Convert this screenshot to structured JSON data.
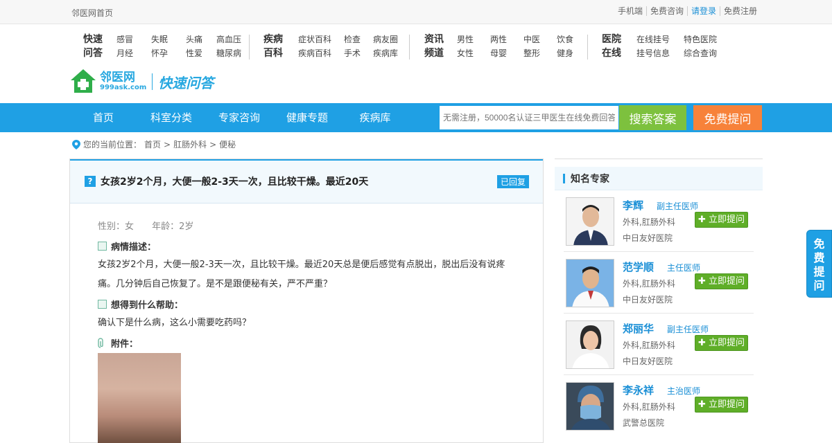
{
  "topbar": {
    "home": "邻医网首页",
    "links": [
      "手机端",
      "免费咨询",
      "请登录",
      "免费注册"
    ]
  },
  "menu": [
    {
      "cat": [
        "快速",
        "问答"
      ],
      "items": [
        "感冒",
        "月经",
        "失眠",
        "怀孕",
        "头痛",
        "性爱",
        "高血压",
        "糖尿病"
      ]
    },
    {
      "cat": [
        "疾病",
        "百科"
      ],
      "items": [
        "症状百科",
        "疾病百科",
        "检查",
        "手术",
        "病友圈",
        "疾病库"
      ]
    },
    {
      "cat": [
        "资讯",
        "频道"
      ],
      "items": [
        "男性",
        "女性",
        "两性",
        "母婴",
        "中医",
        "整形",
        "饮食",
        "健身"
      ]
    },
    {
      "cat": [
        "医院",
        "在线"
      ],
      "items": [
        "在线挂号",
        "挂号信息",
        "特色医院",
        "综合查询"
      ]
    }
  ],
  "logo": {
    "name": "邻医网",
    "domain": "999ask.com",
    "tagline": "快速问答"
  },
  "nav": {
    "items": [
      "首页",
      "科室分类",
      "专家咨询",
      "健康专题",
      "疾病库"
    ],
    "search_placeholder": "无需注册，50000名认证三甲医生在线免费回答",
    "search_button": "搜索答案",
    "ask_button": "免费提问"
  },
  "breadcrumb": {
    "prefix": "您的当前位置：",
    "items": [
      "首页",
      "肛肠外科",
      "便秘"
    ],
    "sep": " > "
  },
  "question": {
    "title": "女孩2岁2个月，大便一般2-3天一次，且比较干燥。最近20天",
    "status": "已回复",
    "gender": "性别：女",
    "age": "年龄：2岁",
    "desc_label": "病情描述：",
    "desc": "女孩2岁2个月，大便一般2-3天一次，且比较干燥。最近20天总是便后感觉有点脱出，脱出后没有说疼痛。几分钟后自己恢复了。是不是跟便秘有关，严不严重？",
    "help_label": "想得到什么帮助：",
    "help": "确认下是什么病，这么小需要吃药吗？",
    "attach_label": "附件："
  },
  "sidebar": {
    "title": "知名专家",
    "doctors": [
      {
        "name": "李辉",
        "title": "副主任医师",
        "dept": "外科,肛肠外科",
        "hospital": "中日友好医院",
        "button": "立即提问"
      },
      {
        "name": "范学顺",
        "title": "主任医师",
        "dept": "外科,肛肠外科",
        "hospital": "中日友好医院",
        "button": "立即提问"
      },
      {
        "name": "郑丽华",
        "title": "副主任医师",
        "dept": "外科,肛肠外科",
        "hospital": "中日友好医院",
        "button": "立即提问"
      },
      {
        "name": "李永祥",
        "title": "主治医师",
        "dept": "外科,肛肠外科",
        "hospital": "武警总医院",
        "button": "立即提问"
      }
    ]
  },
  "float": {
    "label": "免费提问"
  }
}
